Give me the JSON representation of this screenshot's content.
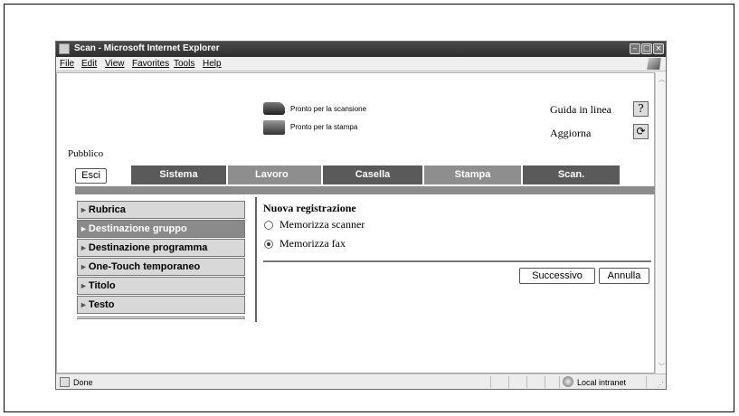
{
  "window": {
    "title": "Scan - Microsoft Internet Explorer",
    "controls": [
      "minimize-icon",
      "maximize-icon",
      "close-icon"
    ]
  },
  "menubar": {
    "items": [
      {
        "label": "File",
        "underline_index": 0
      },
      {
        "label": "Edit",
        "underline_index": 0
      },
      {
        "label": "View",
        "underline_index": 0
      },
      {
        "label": "Favorites",
        "underline_index": 1
      },
      {
        "label": "Tools",
        "underline_index": 0
      },
      {
        "label": "Help",
        "underline_index": 0
      }
    ]
  },
  "status_panel": {
    "scanner_status": "Pronto per la scansione",
    "printer_status": "Pronto per la stampa",
    "help_link": "Guida in linea",
    "refresh_link": "Aggiorna",
    "user_mode": "Pubblico"
  },
  "nav": {
    "logout_label": "Esci",
    "tabs": [
      "Sistema",
      "Lavoro",
      "Casella",
      "Stampa",
      "Scan."
    ],
    "active_tab": "Scan."
  },
  "sidebar": {
    "items": [
      {
        "label": "Rubrica",
        "active": false
      },
      {
        "label": "Destinazione gruppo",
        "active": true
      },
      {
        "label": "Destinazione programma",
        "active": false
      },
      {
        "label": "One-Touch temporaneo",
        "active": false
      },
      {
        "label": "Titolo",
        "active": false
      },
      {
        "label": "Testo",
        "active": false
      }
    ]
  },
  "main": {
    "heading": "Nuova registrazione",
    "options": [
      {
        "label": "Memorizza scanner",
        "checked": false
      },
      {
        "label": "Memorizza fax",
        "checked": true
      }
    ],
    "next_button": "Successivo",
    "cancel_button": "Annulla"
  },
  "statusbar": {
    "left_text": "Done",
    "zone_text": "Local intranet"
  }
}
